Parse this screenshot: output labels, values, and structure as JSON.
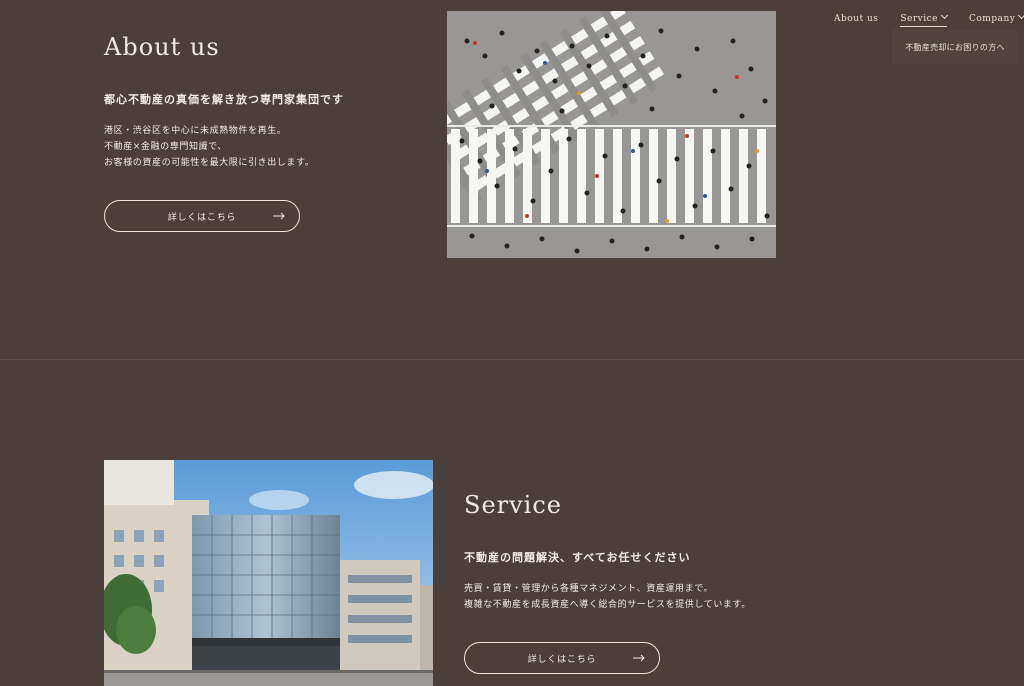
{
  "nav": {
    "items": [
      {
        "label": "About us",
        "has_dropdown": false,
        "active": false
      },
      {
        "label": "Service",
        "has_dropdown": true,
        "active": true
      },
      {
        "label": "Company",
        "has_dropdown": true,
        "active": false
      }
    ],
    "dropdown_item": "不動産売却にお困りの方へ"
  },
  "about": {
    "title": "About us",
    "subtitle": "都心不動産の真価を解き放つ専門家集団です",
    "lines": [
      "港区・渋谷区を中心に未成熟物件を再生。",
      "不動産×金融の専門知識で、",
      "お客様の資産の可能性を最大限に引き出します。"
    ],
    "button_label": "詳しくはこちら"
  },
  "service": {
    "title": "Service",
    "subtitle": "不動産の問題解決、すべてお任せください",
    "lines": [
      "売買・賃貸・管理から各種マネジメント、資産運用まで。",
      "複雑な不動産を成長資産へ導く総合的サービスを提供しています。"
    ],
    "button_label": "詳しくはこちら"
  },
  "images": {
    "crowd": "crosswalk-crowd-photo",
    "building": "office-building-photo"
  },
  "colors": {
    "background": "#4b3f3b",
    "text": "#f1ebe6",
    "divider": "#5d514d"
  }
}
